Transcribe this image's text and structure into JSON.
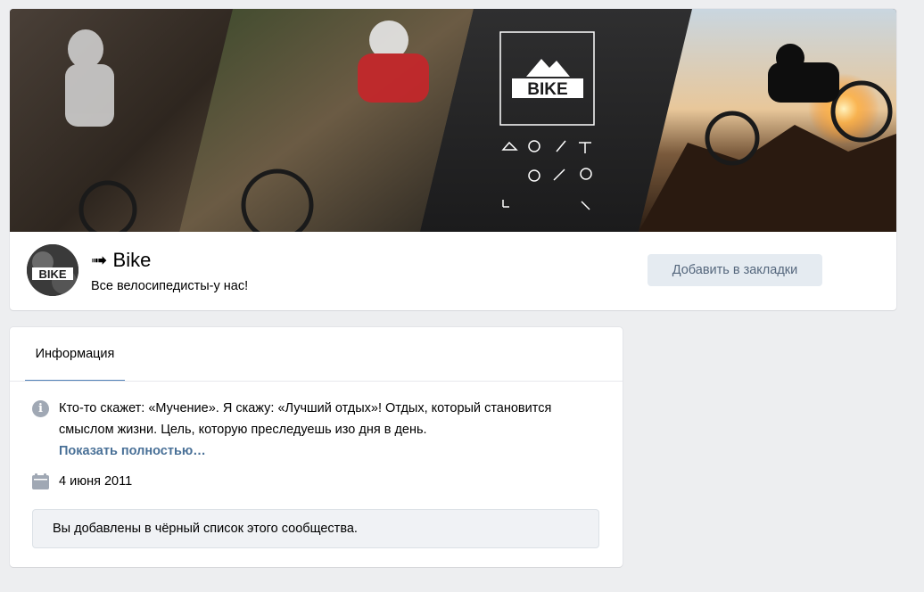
{
  "group": {
    "name": "➟ Bike",
    "status": "Все велосипедисты-у нас!",
    "bookmark_label": "Добавить в закладки",
    "logo_text": "BIKE",
    "avatar_text": "BIKE"
  },
  "info": {
    "tab_label": "Информация",
    "description": "Кто-то скажет: «Мучение». Я скажу: «Лучший отдых»! Отдых, который становится смыслом жизни. Цель, которую преследуешь изо дня в день.",
    "show_more": "Показать полностью…",
    "founded": "4 июня 2011",
    "blacklist_notice": "Вы добавлены в чёрный список этого сообщества."
  },
  "icons": {
    "info": "info-circle-icon",
    "calendar": "calendar-icon"
  },
  "colors": {
    "page_bg": "#edeef0",
    "link": "#2a5885",
    "accent": "#5181b8",
    "button_bg": "#e5ebf1",
    "button_text": "#55677d"
  }
}
